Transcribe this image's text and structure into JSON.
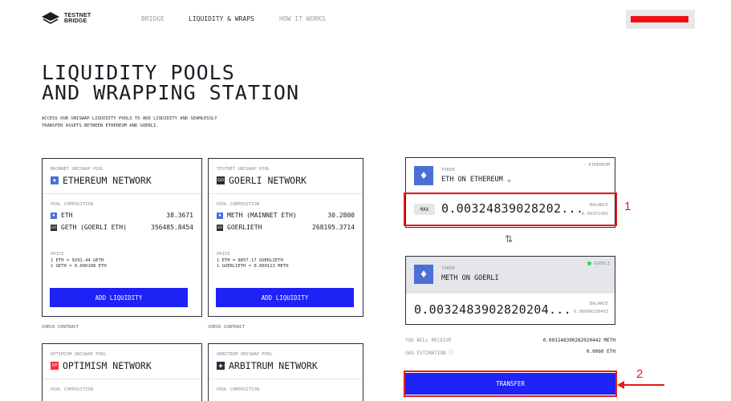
{
  "header": {
    "logo_line1": "TESTNET",
    "logo_line2": "BRIDGE",
    "nav": [
      "BRIDGE",
      "LIQUIDITY & WRAPS",
      "HOW IT WORKS"
    ],
    "active_nav": "LIQUIDITY & WRAPS"
  },
  "hero": {
    "title_line1": "LIQUIDITY POOLS",
    "title_line2": "AND WRAPPING STATION",
    "subtitle_line1": "ACCESS OUR UNISWAP LIQUIDITY POOLS TO ADD LIQUIDITY AND SEAMLESSLY",
    "subtitle_line2": "TRANSFER ASSETS BETWEEN ETHEREUM AND GOERLI."
  },
  "pools": {
    "mainnet": {
      "kicker": "MAINNET UNISWAP POOL",
      "title": "ETHEREUM NETWORK",
      "composition_label": "POOL COMPOSITION",
      "row1_name": "ETH",
      "row1_value": "38.3671",
      "row2_name": "GETH (GOERLI ETH)",
      "row2_value": "356485.8454",
      "price_label": "PRICE",
      "price_line1": "1 ETH = 9291.44 GETH",
      "price_line2": "1 GETH = 0.000108 ETH",
      "button": "ADD LIQUIDITY",
      "check": "CHECK CONTRACT"
    },
    "testnet": {
      "kicker": "TESTNET UNISWAP POOL",
      "title": "GOERLI NETWORK",
      "composition_label": "POOL COMPOSITION",
      "row1_name": "METH (MAINNET ETH)",
      "row1_value": "30.2800",
      "row2_name": "GOERLIETH",
      "row2_value": "268195.3714",
      "price_label": "PRICE",
      "price_line1": "1 ETH = 8857.17 GOERLIETH",
      "price_line2": "1 GOERLIETH = 0.000113 METH",
      "button": "ADD LIQUIDITY",
      "check": "CHECK CONTRACT"
    },
    "optimism": {
      "kicker": "OPTIMISM UNISWAP POOL",
      "title": "OPTIMISM NETWORK",
      "composition_label": "POOL COMPOSITION"
    },
    "arbitrum": {
      "kicker": "ARBITRUM UNISWAP POOL",
      "title": "ARBITRUM NETWORK",
      "composition_label": "POOL COMPOSITION"
    }
  },
  "swap": {
    "from": {
      "chain": "ETHEREUM",
      "token_label": "TOKEN",
      "token_name": "ETH ON ETHEREUM",
      "max_label": "MAX",
      "amount": "0.00324839028202...",
      "balance_label": "BALANCE",
      "balance_value": "0.00351492"
    },
    "to": {
      "chain": "GOERLI",
      "token_label": "TOKEN",
      "token_name": "METH ON GOERLI",
      "amount": "0.0032483902820204...",
      "balance_label": "BALANCE",
      "balance_value": "0.00000158493"
    },
    "receive_label": "YOU WILL RECEIVE",
    "receive_value": "0.003248390282020442 METH",
    "gas_label": "GAS ESTIMATION",
    "gas_value": "0.0060 ETH",
    "transfer_button": "TRANSFER"
  },
  "annotations": {
    "callout1": "1",
    "callout2": "2"
  },
  "colors": {
    "accent_blue": "#1e22f5",
    "highlight_red": "#e31b1b",
    "eth_blue": "#4a6fd6",
    "optimism_red": "#ff2c3a",
    "online_green": "#2bd46b"
  }
}
